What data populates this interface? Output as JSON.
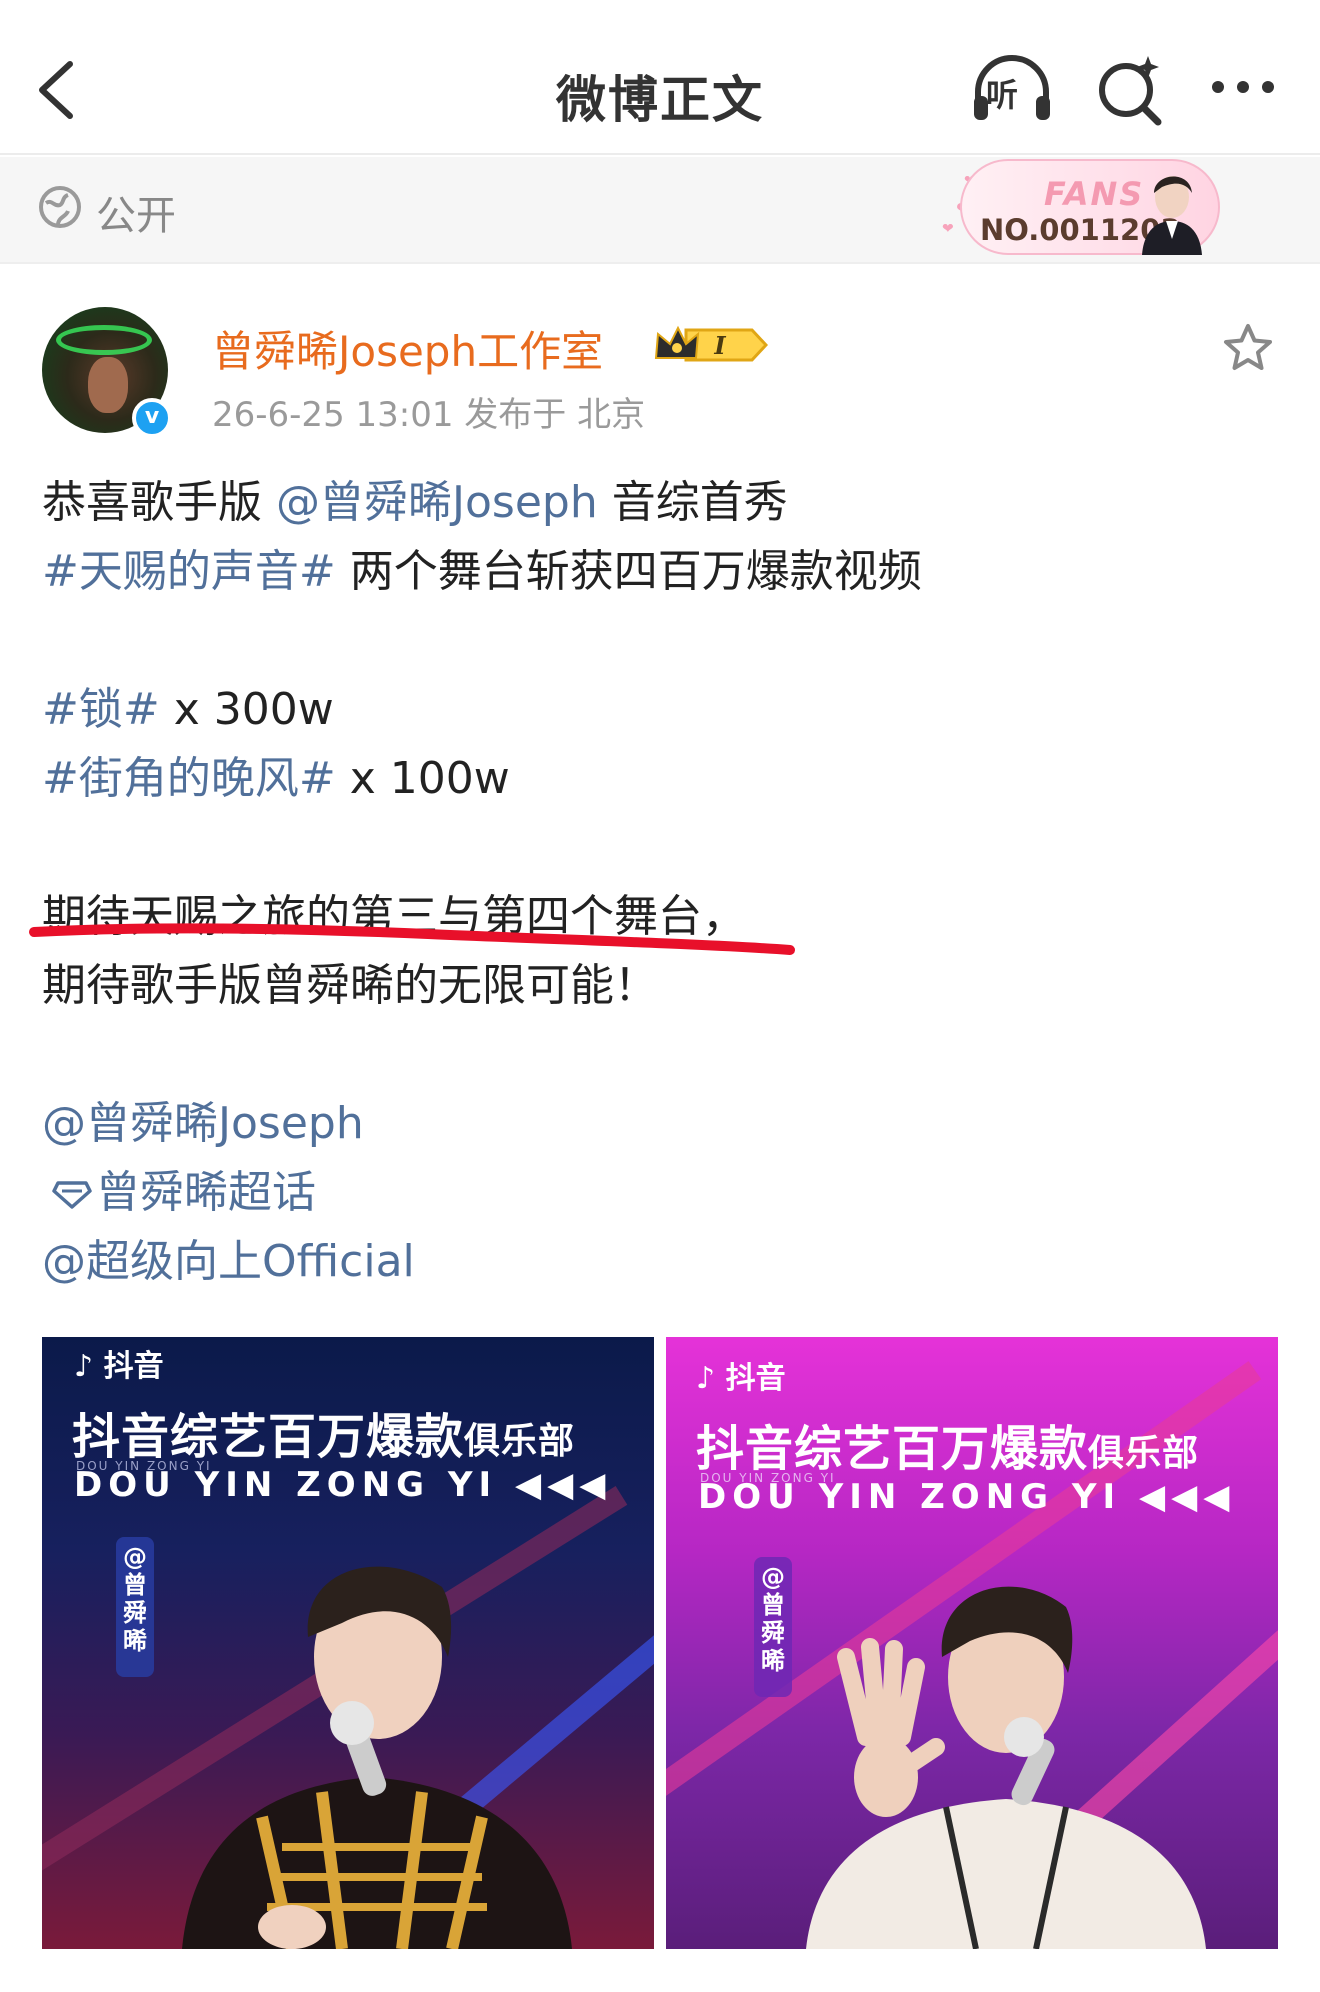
{
  "nav": {
    "title": "微博正文",
    "listen_label": "听"
  },
  "visibility": {
    "label": "公开"
  },
  "fans_badge": {
    "word": "FANS",
    "number": "NO.0011203"
  },
  "author": {
    "name": "曾舜晞Joseph工作室",
    "badge_level": "I",
    "meta": "26-6-25 13:01   发布于 北京",
    "verified_mark": "v"
  },
  "post": {
    "l1_a": "恭喜歌手版 ",
    "l1_link": "@曾舜晞Joseph",
    "l1_b": " 音综首秀",
    "l2_link": "#天赐的声音#",
    "l2_b": " 两个舞台斩获四百万爆款视频",
    "l3_link": "#锁#",
    "l3_b": "  x  300w",
    "l4_link": "#街角的晚风#",
    "l4_b": "  x  100w",
    "l5": "期待天赐之旅的第三与第四个舞台，",
    "l6": "期待歌手版曾舜晞的无限可能！",
    "l7_link": "@曾舜晞Joseph",
    "l8_link": "曾舜晞超话",
    "l9_link": "@超级向上Official"
  },
  "images": [
    {
      "app": "♪ 抖音",
      "headline": "抖音综艺百万爆款",
      "headline_small": "俱乐部",
      "pinyin_small": "DOU YIN ZONG YI",
      "pinyin": "DOU YIN ZONG YI ◀◀◀",
      "tag": "@曾舜晞"
    },
    {
      "app": "♪ 抖音",
      "headline": "抖音综艺百万爆款",
      "headline_small": "俱乐部",
      "pinyin_small": "DOU YIN ZONG YI",
      "pinyin": "DOU YIN ZONG YI ◀◀◀",
      "tag": "@曾舜晞"
    }
  ],
  "colors": {
    "link": "#51709a",
    "username": "#e86b1e",
    "annotation": "#e8102a",
    "verified": "#1da1f2"
  },
  "icons": [
    "back-arrow-icon",
    "headphones-icon",
    "search-sparkle-icon",
    "more-dots-icon",
    "globe-icon",
    "star-icon",
    "supertopic-diamond-icon",
    "crown-icon"
  ]
}
